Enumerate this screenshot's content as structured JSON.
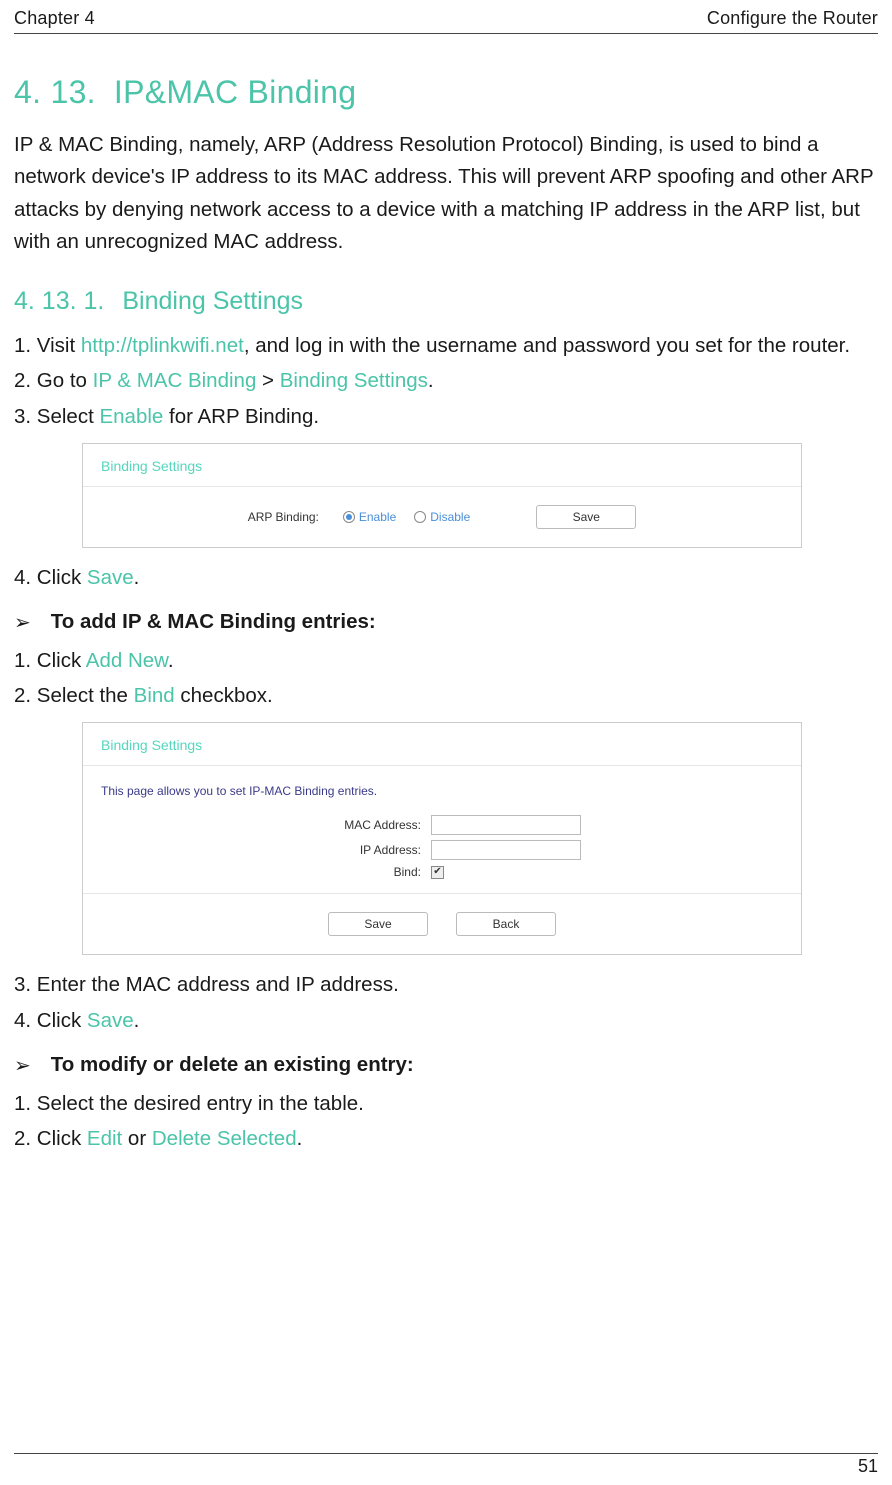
{
  "header": {
    "left": "Chapter 4",
    "right": "Configure the Router"
  },
  "h1": {
    "num": "4. 13.",
    "title": "IP&MAC Binding"
  },
  "intro": "IP & MAC Binding, namely, ARP (Address Resolution Protocol) Binding, is used to bind a network device's IP address to its MAC address. This will prevent ARP spoofing and other ARP attacks by denying network access to a device with a matching IP address in the ARP list, but with an unrecognized MAC address.",
  "h2": {
    "num": "4. 13. 1.",
    "title": "Binding Settings"
  },
  "steps1": {
    "s1_a": "1. Visit ",
    "s1_link": "http://tplinkwifi.net",
    "s1_b": ", and log in with the username and password you set for the router.",
    "s2_a": "2. Go to ",
    "s2_link1": "IP & MAC Binding",
    "s2_mid": " > ",
    "s2_link2": "Binding Settings",
    "s2_end": ".",
    "s3_a": "3. Select ",
    "s3_link": "Enable",
    "s3_b": " for ARP Binding."
  },
  "panel1": {
    "title": "Binding Settings",
    "arp_label": "ARP Binding:",
    "opt_enable": "Enable",
    "opt_disable": "Disable",
    "save": "Save"
  },
  "step4_a": "4. Click ",
  "step4_link": "Save",
  "step4_b": ".",
  "arrow1_title": "To add IP & MAC Binding entries:",
  "add": {
    "s1_a": "1. Click ",
    "s1_link": "Add New",
    "s1_b": ".",
    "s2_a": "2. Select the ",
    "s2_link": "Bind",
    "s2_b": " checkbox."
  },
  "panel2": {
    "title": "Binding Settings",
    "desc": "This page allows you to set IP-MAC Binding entries.",
    "mac_label": "MAC Address:",
    "ip_label": "IP Address:",
    "bind_label": "Bind:",
    "save": "Save",
    "back": "Back"
  },
  "after_panel2": {
    "s3": "3. Enter the MAC address and IP address.",
    "s4_a": "4. Click ",
    "s4_link": "Save",
    "s4_b": "."
  },
  "arrow2_title": "To modify or delete an existing entry:",
  "modify": {
    "s1": "1. Select the desired entry in the table.",
    "s2_a": "2. Click ",
    "s2_link1": "Edit",
    "s2_mid": " or ",
    "s2_link2": "Delete Selected",
    "s2_end": "."
  },
  "page_number": "51"
}
